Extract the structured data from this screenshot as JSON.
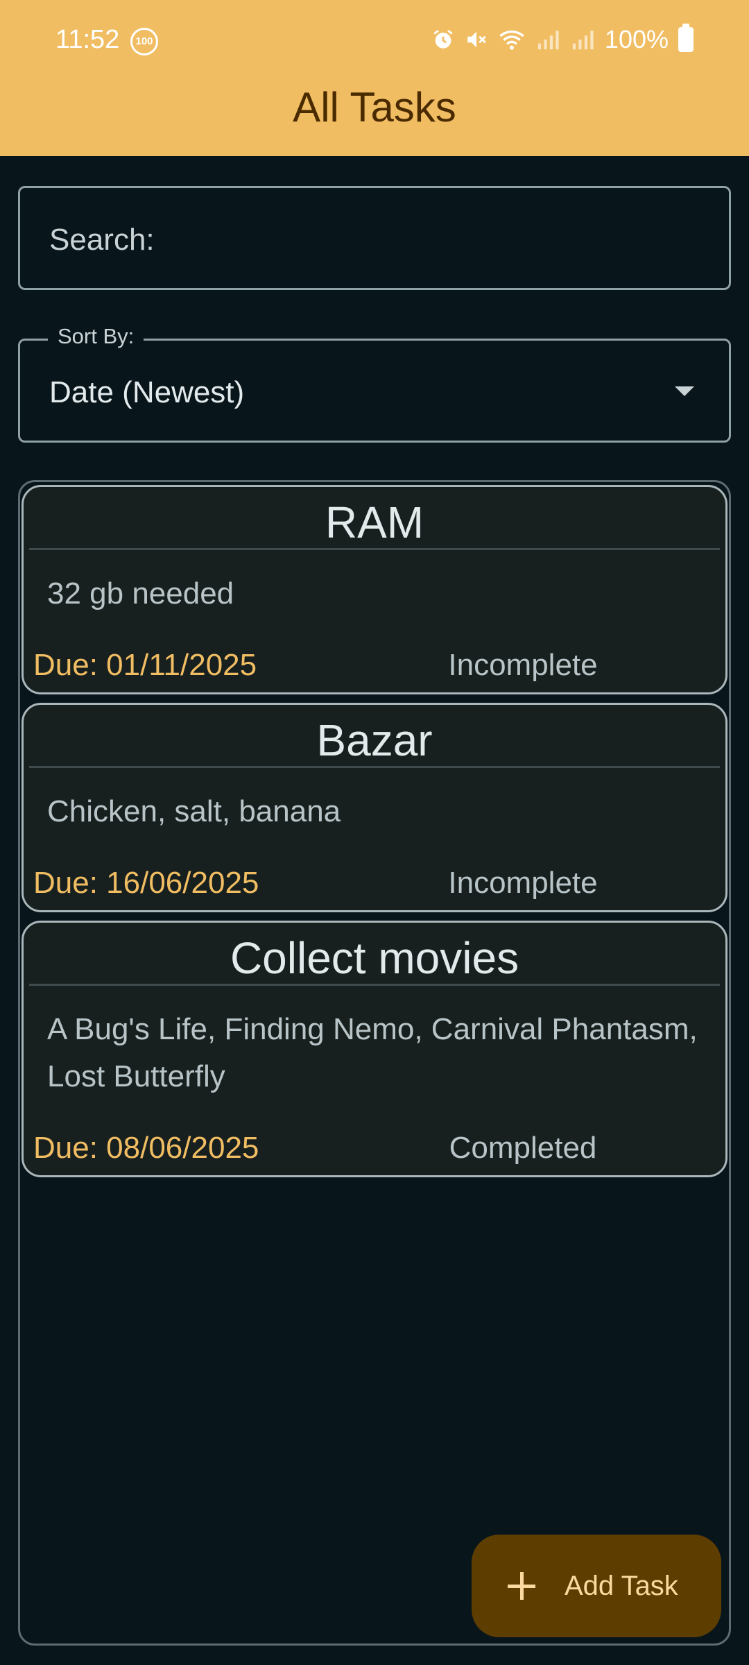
{
  "status_bar": {
    "time": "11:52",
    "badge": "100",
    "battery": "100%"
  },
  "header": {
    "title": "All Tasks"
  },
  "search": {
    "label": "Search:"
  },
  "sort": {
    "legend": "Sort By:",
    "value": "Date (Newest)"
  },
  "tasks": [
    {
      "title": "RAM",
      "description": "32 gb needed",
      "due": "Due: 01/11/2025",
      "status": "Incomplete"
    },
    {
      "title": "Bazar",
      "description": "Chicken, salt, banana",
      "due": "Due: 16/06/2025",
      "status": "Incomplete"
    },
    {
      "title": "Collect movies",
      "description": "A Bug's Life, Finding Nemo, Carnival Phantasm, Lost Butterfly",
      "due": "Due: 08/06/2025",
      "status": "Completed"
    }
  ],
  "fab": {
    "label": "Add Task"
  },
  "colors": {
    "header_bg": "#f1bd63",
    "page_bg": "#08151b",
    "card_bg": "#18201f",
    "due_text": "#f1bd63",
    "fab_bg": "#5e3e00"
  }
}
